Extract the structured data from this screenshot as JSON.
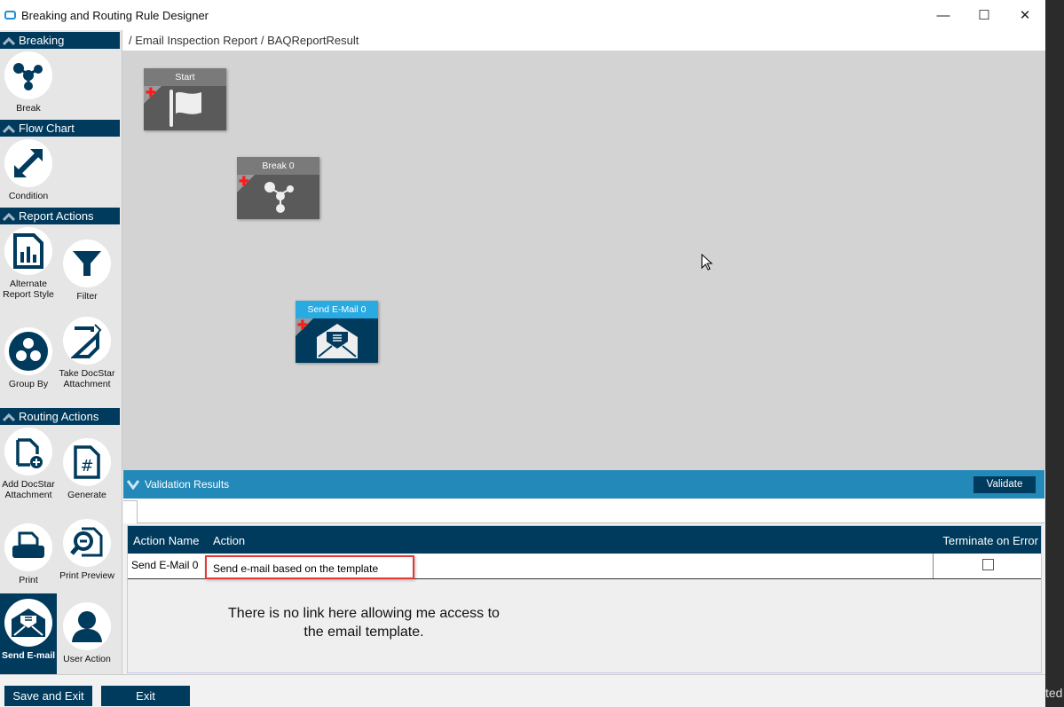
{
  "window": {
    "title": "Breaking and Routing Rule Designer",
    "minimize": "—",
    "maximize": "☐",
    "close": "✕"
  },
  "breadcrumb": "/ Email Inspection Report / BAQReportResult",
  "sidebar": {
    "sections": [
      "Breaking",
      "Flow Chart",
      "Report Actions",
      "Routing Actions"
    ],
    "tools": {
      "break": "Break",
      "condition": "Condition",
      "alternate": "Alternate Report Style",
      "filter": "Filter",
      "group_by": "Group By",
      "take_docstar": "Take DocStar Attachment",
      "add_docstar": "Add DocStar Attachment",
      "generate": "Generate",
      "print": "Print",
      "print_preview": "Print Preview",
      "send_email": "Send E-mail",
      "user_action": "User Action"
    }
  },
  "canvas": {
    "nodes": {
      "start": "Start",
      "break": "Break 0",
      "send_email": "Send E-Mail 0"
    }
  },
  "validation": {
    "title": "Validation Results",
    "validate_label": "Validate",
    "columns": [
      "Action Name",
      "Action",
      "Terminate on Error"
    ],
    "rows": [
      {
        "action_name": "Send E-Mail 0",
        "action": "Send e-mail based on the  template",
        "terminate": false
      }
    ]
  },
  "annotation": "There is no link here allowing me access to the email template.",
  "footer": {
    "save_exit": "Save and Exit",
    "exit": "Exit"
  },
  "background_text": "ted",
  "colors": {
    "navy": "#003a5c",
    "blue": "#2389b9",
    "highlight": "#e53935"
  }
}
